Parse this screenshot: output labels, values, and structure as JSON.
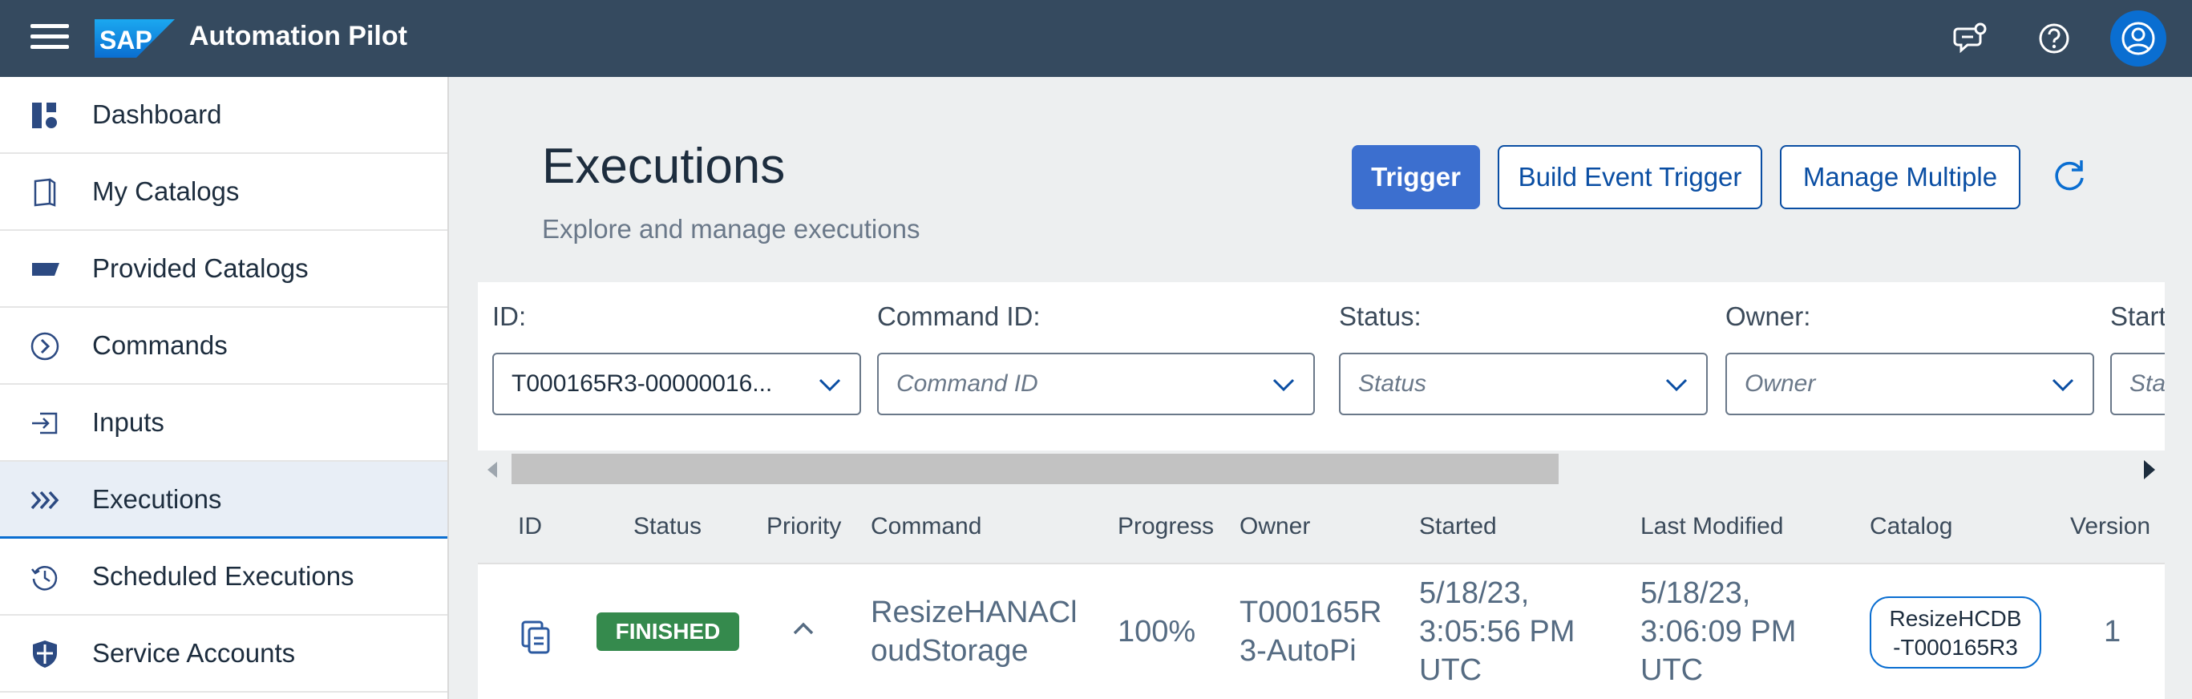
{
  "shell": {
    "brand": "SAP",
    "app_title": "Automation Pilot",
    "icons": [
      "menu-icon",
      "feedback-icon",
      "help-icon",
      "user-avatar-icon"
    ]
  },
  "sidebar": {
    "items": [
      {
        "label": "Dashboard",
        "icon": "dashboard-icon"
      },
      {
        "label": "My Catalogs",
        "icon": "catalog-icon"
      },
      {
        "label": "Provided Catalogs",
        "icon": "tag-icon"
      },
      {
        "label": "Commands",
        "icon": "command-icon"
      },
      {
        "label": "Inputs",
        "icon": "inputs-icon"
      },
      {
        "label": "Executions",
        "icon": "executions-icon",
        "active": true
      },
      {
        "label": "Scheduled Executions",
        "icon": "scheduled-icon"
      },
      {
        "label": "Service Accounts",
        "icon": "shield-icon"
      }
    ]
  },
  "header": {
    "title": "Executions",
    "subtitle": "Explore and manage executions",
    "buttons": {
      "trigger": "Trigger",
      "build_event_trigger": "Build Event Trigger",
      "manage_multiple": "Manage Multiple"
    }
  },
  "filters": {
    "id": {
      "label": "ID:",
      "value": "T000165R3-00000016..."
    },
    "command_id": {
      "label": "Command ID:",
      "placeholder": "Command ID"
    },
    "status": {
      "label": "Status:",
      "placeholder": "Status"
    },
    "owner": {
      "label": "Owner:",
      "placeholder": "Owner"
    },
    "started": {
      "label": "Start",
      "placeholder": "Sta"
    }
  },
  "table": {
    "columns": [
      "ID",
      "Status",
      "Priority",
      "Command",
      "Progress",
      "Owner",
      "Started",
      "Last Modified",
      "Catalog",
      "Version"
    ],
    "rows": [
      {
        "status": "FINISHED",
        "command": [
          "ResizeHANACl",
          "oudStorage"
        ],
        "progress": "100%",
        "owner": [
          "T000165R",
          "3-AutoPi"
        ],
        "started": [
          "5/18/23,",
          "3:05:56 PM",
          "UTC"
        ],
        "last_modified": [
          "5/18/23,",
          "3:06:09 PM",
          "UTC"
        ],
        "catalog": [
          "ResizeHCDB",
          "-T000165R3"
        ],
        "version": "1"
      }
    ]
  },
  "colors": {
    "shell_bg": "#354a5f",
    "primary_button": "#3c6fcf",
    "status_finished": "#358a4d",
    "accent": "#0a6ed1"
  }
}
